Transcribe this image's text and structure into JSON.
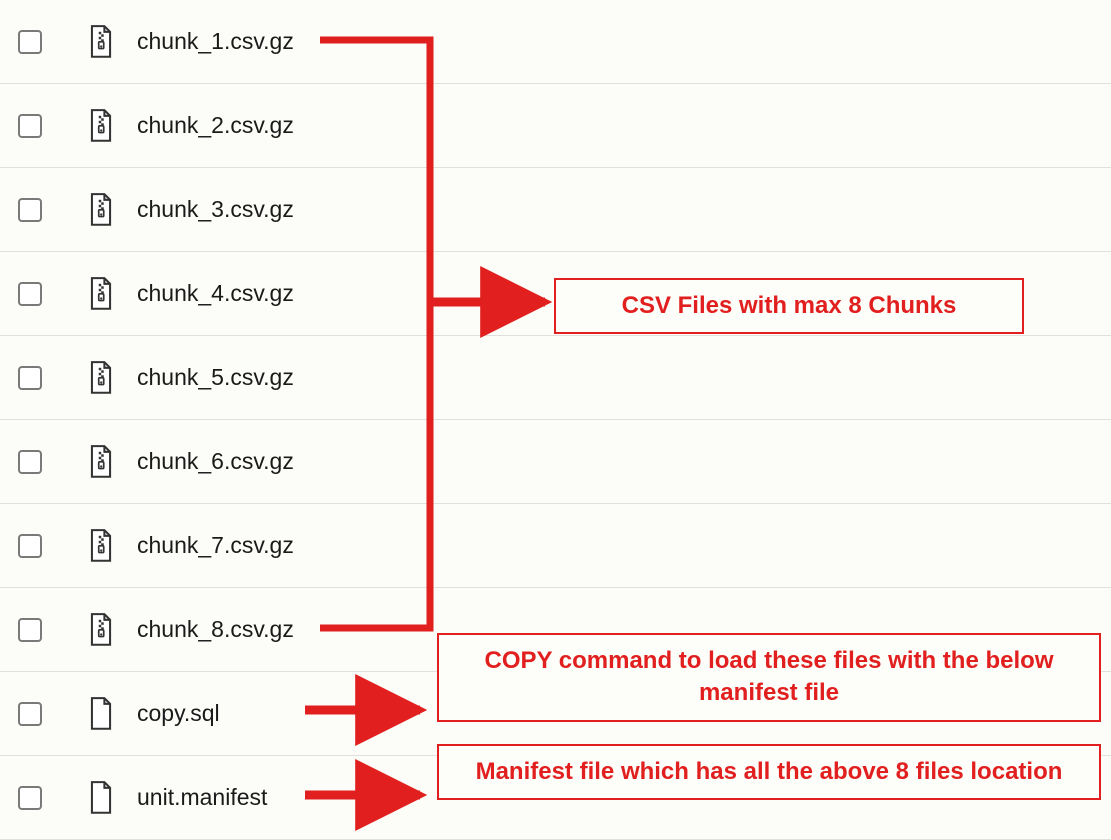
{
  "files": [
    {
      "name": "chunk_1.csv.gz",
      "kind": "archive"
    },
    {
      "name": "chunk_2.csv.gz",
      "kind": "archive"
    },
    {
      "name": "chunk_3.csv.gz",
      "kind": "archive"
    },
    {
      "name": "chunk_4.csv.gz",
      "kind": "archive"
    },
    {
      "name": "chunk_5.csv.gz",
      "kind": "archive"
    },
    {
      "name": "chunk_6.csv.gz",
      "kind": "archive"
    },
    {
      "name": "chunk_7.csv.gz",
      "kind": "archive"
    },
    {
      "name": "chunk_8.csv.gz",
      "kind": "archive"
    },
    {
      "name": "copy.sql",
      "kind": "plain"
    },
    {
      "name": "unit.manifest",
      "kind": "plain"
    }
  ],
  "callouts": {
    "chunks": "CSV Files with max 8 Chunks",
    "copy": "COPY command to load these files with the below manifest file",
    "manifest": "Manifest file which has all the above 8 files location"
  },
  "colors": {
    "annotation": "#e11f1f"
  }
}
